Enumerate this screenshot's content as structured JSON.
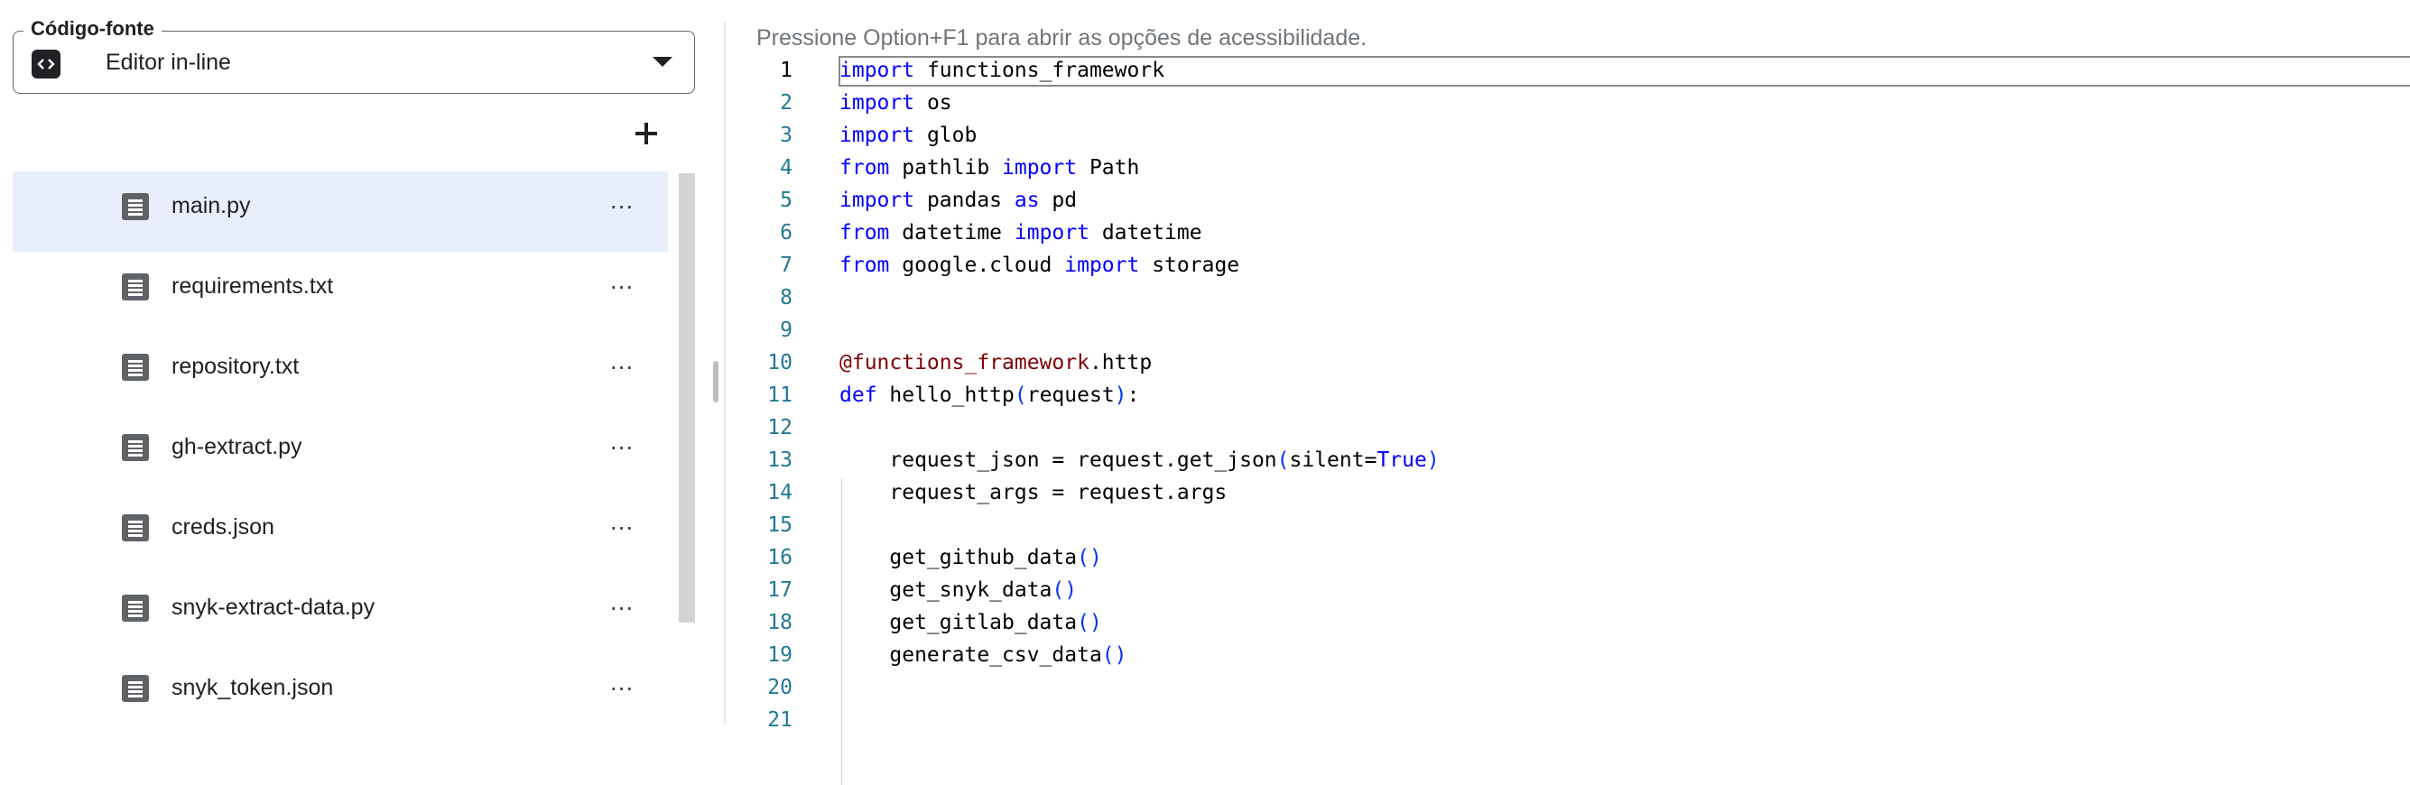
{
  "source": {
    "legend": "Código-fonte",
    "value": "Editor in-line"
  },
  "files": [
    {
      "name": "main.py",
      "selected": true
    },
    {
      "name": "requirements.txt",
      "selected": false
    },
    {
      "name": "repository.txt",
      "selected": false
    },
    {
      "name": "gh-extract.py",
      "selected": false
    },
    {
      "name": "creds.json",
      "selected": false
    },
    {
      "name": "snyk-extract-data.py",
      "selected": false
    },
    {
      "name": "snyk_token.json",
      "selected": false
    }
  ],
  "file_more_label": "...",
  "editor": {
    "accessibility_hint": "Pressione Option+F1 para abrir as opções de acessibilidade.",
    "active_line": 1,
    "lines": [
      [
        [
          "kw",
          "import"
        ],
        [
          "t",
          " functions_framework"
        ]
      ],
      [
        [
          "kw",
          "import"
        ],
        [
          "t",
          " os"
        ]
      ],
      [
        [
          "kw",
          "import"
        ],
        [
          "t",
          " glob"
        ]
      ],
      [
        [
          "kw",
          "from"
        ],
        [
          "t",
          " pathlib "
        ],
        [
          "kw",
          "import"
        ],
        [
          "t",
          " Path"
        ]
      ],
      [
        [
          "kw",
          "import"
        ],
        [
          "t",
          " pandas "
        ],
        [
          "kw",
          "as"
        ],
        [
          "t",
          " pd"
        ]
      ],
      [
        [
          "kw",
          "from"
        ],
        [
          "t",
          " datetime "
        ],
        [
          "kw",
          "import"
        ],
        [
          "t",
          " datetime"
        ]
      ],
      [
        [
          "kw",
          "from"
        ],
        [
          "t",
          " google.cloud "
        ],
        [
          "kw",
          "import"
        ],
        [
          "t",
          " storage"
        ]
      ],
      [],
      [],
      [
        [
          "deco",
          "@functions_framework"
        ],
        [
          "t",
          ".http"
        ]
      ],
      [
        [
          "kw",
          "def"
        ],
        [
          "t",
          " hello_http"
        ],
        [
          "br",
          "("
        ],
        [
          "t",
          "request"
        ],
        [
          "br",
          ")"
        ],
        [
          "t",
          ":"
        ]
      ],
      [],
      [
        [
          "t",
          "    request_json = request.get_json"
        ],
        [
          "br",
          "("
        ],
        [
          "t",
          "silent="
        ],
        [
          "kw",
          "True"
        ],
        [
          "br",
          ")"
        ]
      ],
      [
        [
          "t",
          "    request_args = request.args"
        ]
      ],
      [],
      [
        [
          "t",
          "    get_github_data"
        ],
        [
          "br",
          "()"
        ]
      ],
      [
        [
          "t",
          "    get_snyk_data"
        ],
        [
          "br",
          "()"
        ]
      ],
      [
        [
          "t",
          "    get_gitlab_data"
        ],
        [
          "br",
          "()"
        ]
      ],
      [
        [
          "t",
          "    generate_csv_data"
        ],
        [
          "br",
          "()"
        ]
      ],
      [],
      []
    ]
  }
}
